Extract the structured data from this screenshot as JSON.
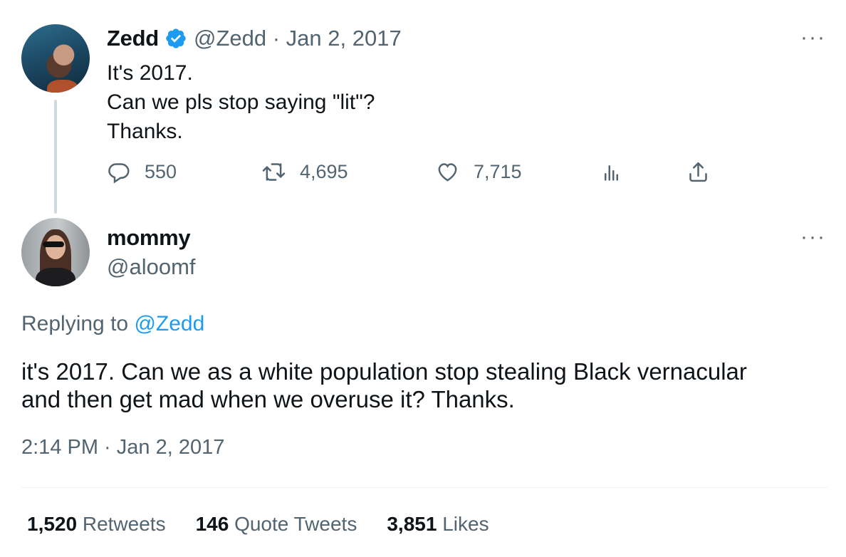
{
  "parent_tweet": {
    "name": "Zedd",
    "verified_icon": "verified-badge-icon",
    "meta": "@Zedd · Jan 2, 2017",
    "text_lines": [
      "It's 2017.",
      "Can we pls stop saying \"lit\"?",
      "Thanks."
    ],
    "actions": {
      "reply_count": "550",
      "retweet_count": "4,695",
      "like_count": "7,715"
    },
    "more": "···"
  },
  "main_tweet": {
    "name": "mommy",
    "handle": "@aloomf",
    "more": "···",
    "replying_prefix": "Replying to",
    "replying_handle": "@Zedd",
    "text_line1": "it's 2017. Can we as a white population stop stealing Black vernacular",
    "text_line2": "and then get mad when we overuse it? Thanks.",
    "timestamp": "2:14 PM · Jan 2, 2017"
  },
  "stats": [
    {
      "num": "1,520",
      "label": "Retweets"
    },
    {
      "num": "146",
      "label": "Quote Tweets"
    },
    {
      "num": "3,851",
      "label": "Likes"
    }
  ],
  "colors": {
    "accent": "#1d9bf0",
    "text": "#0f1419",
    "muted": "#536471",
    "thread_line": "#cfd9de"
  }
}
